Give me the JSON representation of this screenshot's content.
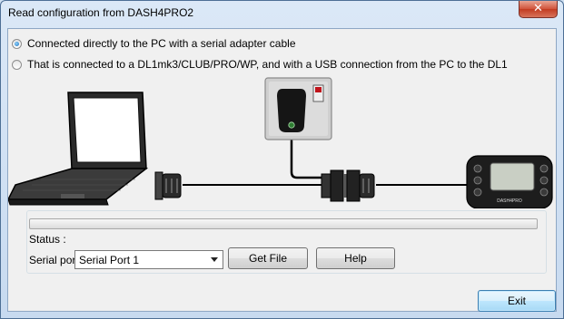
{
  "window": {
    "title": "Read configuration from DASH4PRO2",
    "close_symbol": "✕"
  },
  "options": [
    {
      "label": "Connected directly to the PC with a serial adapter cable",
      "selected": true
    },
    {
      "label": "That is connected to a DL1mk3/CLUB/PRO/WP, and with a USB connection from the PC to the DL1",
      "selected": false
    }
  ],
  "diagram": {
    "icons": [
      "laptop-icon",
      "power-adapter-icon",
      "serial-connector-icon",
      "dash-display-icon"
    ],
    "device_brand": "DASH4PRO"
  },
  "status": {
    "label": "Status :",
    "progress": 0
  },
  "serial": {
    "label": "Serial port",
    "selected": "Serial Port 1"
  },
  "buttons": {
    "get_file": "Get File",
    "help": "Help",
    "exit": "Exit"
  }
}
